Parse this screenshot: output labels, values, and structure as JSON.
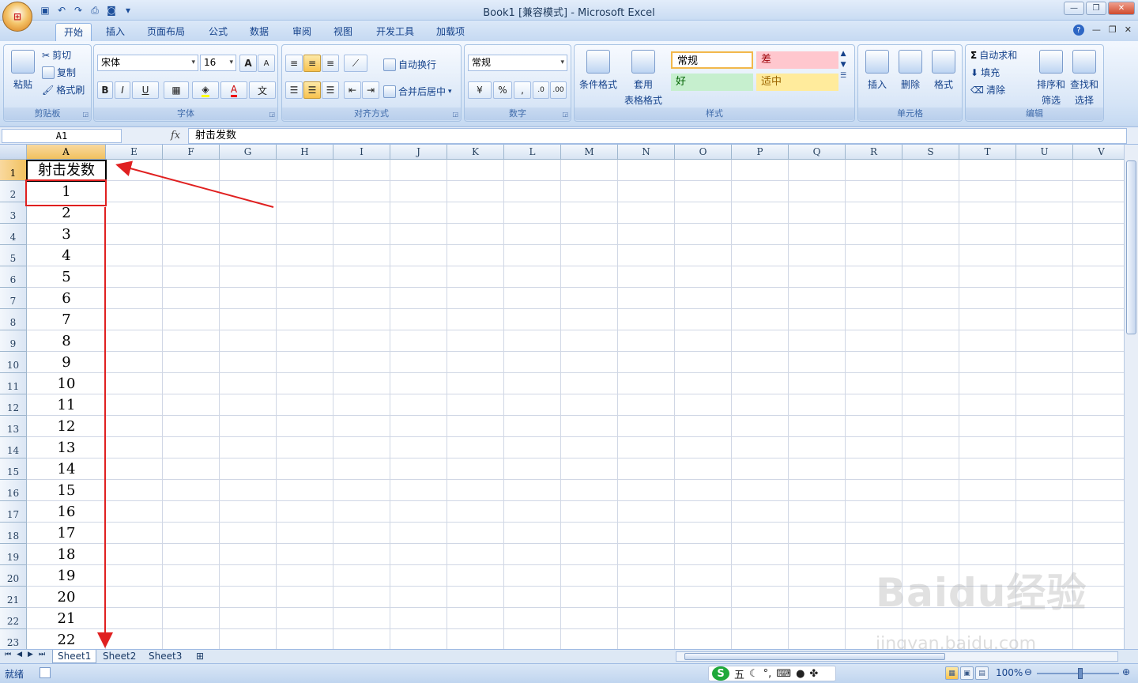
{
  "window": {
    "title": "Book1  [兼容模式] - Microsoft Excel",
    "office_button_icon": "office-logo"
  },
  "qat": [
    "save-icon",
    "undo-icon",
    "redo-icon",
    "print-preview-icon",
    "camera-icon",
    "customize-icon"
  ],
  "ribbon_tabs": [
    "开始",
    "插入",
    "页面布局",
    "公式",
    "数据",
    "审阅",
    "视图",
    "开发工具",
    "加载项"
  ],
  "active_tab": "开始",
  "ribbon": {
    "clipboard": {
      "label": "剪贴板",
      "paste": "粘贴",
      "cut": "剪切",
      "copy": "复制",
      "format_painter": "格式刷"
    },
    "font": {
      "label": "字体",
      "name": "宋体",
      "size": "16",
      "grow": "A",
      "shrink": "A",
      "bold": "B",
      "italic": "I",
      "underline": "U"
    },
    "alignment": {
      "label": "对齐方式",
      "wrap_text": "自动换行",
      "merge_center": "合并后居中"
    },
    "number": {
      "label": "数字",
      "format": "常规",
      "percent": "%",
      "comma": ","
    },
    "styles": {
      "label": "样式",
      "conditional_format": "条件格式",
      "table_format_1": "套用",
      "table_format_2": "表格格式",
      "normal": "常规",
      "bad": "差",
      "good": "好",
      "neutral": "适中"
    },
    "cells": {
      "label": "单元格",
      "insert": "插入",
      "delete": "删除",
      "format": "格式"
    },
    "editing": {
      "label": "编辑",
      "autosum": "自动求和",
      "fill": "填充",
      "clear": "清除",
      "sort_filter_1": "排序和",
      "sort_filter_2": "筛选",
      "find_select_1": "查找和",
      "find_select_2": "选择"
    }
  },
  "formula_bar": {
    "name_box": "A1",
    "fx": "fx",
    "content": "射击发数"
  },
  "columns": [
    "A",
    "E",
    "F",
    "G",
    "H",
    "I",
    "J",
    "K",
    "L",
    "M",
    "N",
    "O",
    "P",
    "Q",
    "R",
    "S",
    "T",
    "U",
    "V"
  ],
  "rows": [
    "1",
    "2",
    "3",
    "4",
    "5",
    "6",
    "7",
    "8",
    "9",
    "10",
    "11",
    "12",
    "13",
    "14",
    "15",
    "16",
    "17",
    "18",
    "19",
    "20",
    "21",
    "22",
    "23"
  ],
  "column_a_values": [
    "射击发数",
    "1",
    "2",
    "3",
    "4",
    "5",
    "6",
    "7",
    "8",
    "9",
    "10",
    "11",
    "12",
    "13",
    "14",
    "15",
    "16",
    "17",
    "18",
    "19",
    "20",
    "21",
    "22"
  ],
  "sheets": [
    "Sheet1",
    "Sheet2",
    "Sheet3"
  ],
  "active_sheet": "Sheet1",
  "status": {
    "ready": "就绪",
    "zoom": "100%"
  },
  "ime": {
    "logo": "S",
    "mode": "五"
  },
  "watermark": {
    "brand": "Baidu经验",
    "url": "jingyan.baidu.com"
  },
  "colors": {
    "annotation_red": "#e02020",
    "selected_header": "#f6c96a",
    "bad_style_bg": "#ffc7ce",
    "good_style_bg": "#c6efce",
    "neutral_style_bg": "#ffeb9c"
  }
}
